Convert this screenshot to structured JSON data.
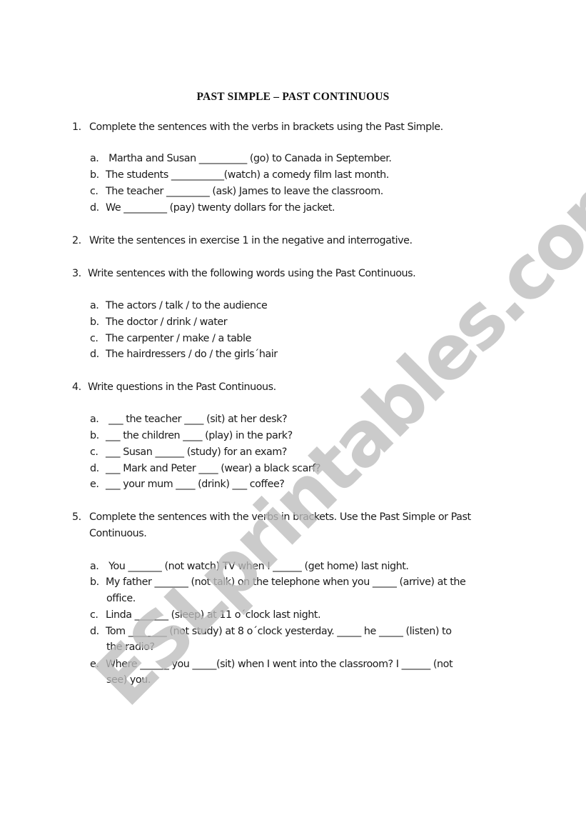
{
  "title": "PAST SIMPLE – PAST CONTINUOUS",
  "watermark": "ESLprintables.com",
  "exercises": [
    {
      "number": "1.",
      "instruction": "Complete the sentences with the verbs in brackets using the Past Simple.",
      "items": [
        {
          "label": "a.",
          "text": " Martha and Susan __________ (go) to Canada in September."
        },
        {
          "label": "b.",
          "text": "The students ___________(watch) a comedy film last month."
        },
        {
          "label": "c.",
          "text": "The teacher _________ (ask) James to leave the classroom."
        },
        {
          "label": "d.",
          "text": "We _________ (pay) twenty dollars for the jacket."
        }
      ]
    },
    {
      "number": "2.",
      "instruction": "Write the sentences in exercise 1 in the negative and interrogative.",
      "items": []
    },
    {
      "number": "3.",
      "instruction": "Write sentences with the following words using the Past Continuous.",
      "items": [
        {
          "label": "a.",
          "text": "The actors / talk / to the audience"
        },
        {
          "label": "b.",
          "text": "The doctor / drink / water"
        },
        {
          "label": "c.",
          "text": "The carpenter / make / a table"
        },
        {
          "label": "d.",
          "text": "The hairdressers / do / the girls´hair"
        }
      ]
    },
    {
      "number": "4.",
      "instruction": "Write questions in the Past Continuous.",
      "items": [
        {
          "label": "a.",
          "text": " ___ the teacher ____ (sit) at her desk?"
        },
        {
          "label": "b.",
          "text": "___ the children ____ (play) in the park?"
        },
        {
          "label": "c.",
          "text": "___ Susan ______ (study) for an exam?"
        },
        {
          "label": "d.",
          "text": "___ Mark and Peter ____ (wear) a black scarf?"
        },
        {
          "label": "e.",
          "text": "___ your mum ____ (drink) ___ coffee?"
        }
      ]
    },
    {
      "number": "5.",
      "instruction_line1": "Complete the sentences with the verbs in brackets.  Use the Past Simple or Past",
      "instruction_line2": "Continuous.",
      "items": [
        {
          "label": "a.",
          "text": " You _______ (not watch) TV when I ______ (get home) last night."
        },
        {
          "label": "b.",
          "text": "My father _______ (not talk) on the telephone when you _____ (arrive) at the",
          "cont": "office."
        },
        {
          "label": "c.",
          "text": "Linda _______ (sleep) at 11 o´clock last night."
        },
        {
          "label": "d.",
          "text": "Tom ________ (not study) at 8 o´clock yesterday.  _____ he _____ (listen) to",
          "cont": "the radio?"
        },
        {
          "label": "e.",
          "text": "Where ______ you _____(sit) when I went into the classroom? I ______ (not",
          "cont": "see) you."
        }
      ]
    }
  ]
}
